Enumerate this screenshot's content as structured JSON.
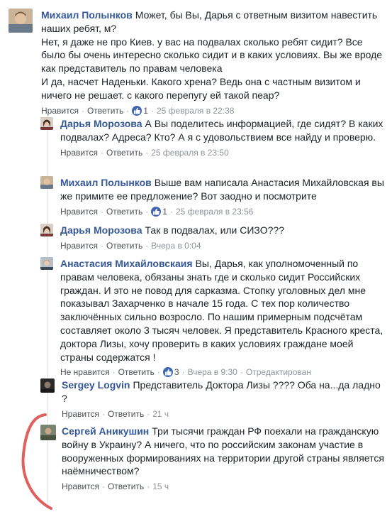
{
  "colors": {
    "author_link": "#365899",
    "action_link": "#4b4f56",
    "meta_text": "#90949c",
    "reaction_blue": "#4267b2",
    "annotation_red": "#e0605e"
  },
  "comments": [
    {
      "author": "Михаил Полынков",
      "paragraphs": [
        "Может, бы Вы, Дарья с ответным визитом навестить наших ребят, м?",
        "Нет, я даже не про Киев. у вас на подвалах сколько ребят сидит? Все было бы очень интересно сколько сидит и в каких условиях. Вы же вроде как представитель по правам человека",
        "И да, насчет Наденьки. Какого хрена? Ведь она с частным визитом и ничего не решает. с какого перепугу ей такой пеар?"
      ],
      "like_label": "Нравится",
      "reply_label": "Ответить",
      "reaction_icon": "like-icon",
      "reaction_count": "1",
      "timestamp": "25 февраля в 22:38"
    },
    {
      "author": "Дарья Морозова",
      "paragraphs": [
        "А Вы поделитесь информацией, где сидят? В каких подвалах? Адреса? Кто? А я с удовольствием все найду и проверю."
      ],
      "like_label": "Нравится",
      "reply_label": "Ответить",
      "timestamp": "25 февраля в 23:50"
    },
    {
      "author": "Михаил Полынков",
      "paragraphs": [
        "Выше вам написала Анастасия Михайловская вы же примите ее предложение? Вот заодно и посмотрите"
      ],
      "like_label": "Нравится",
      "reply_label": "Ответить",
      "reaction_icon": "like-icon",
      "reaction_count": "1",
      "timestamp": "25 февраля в 23:56"
    },
    {
      "author": "Дарья Морозова",
      "paragraphs": [
        "Так в подвалах, или СИЗО???"
      ],
      "like_label": "Нравится",
      "reply_label": "Ответить",
      "timestamp": "Вчера в 0:04"
    },
    {
      "author": "Анастасия Михайловскаия",
      "paragraphs": [
        "Вы, Дарья, как уполномоченный по правам человека, обязаны знать где и сколько сидит Российских граждан. И это не повод для сарказма. Стопку уголовных дел мне показывал Захарченко в начале 15 года. С тех пор количество заключённых сильно возросло. По нашим примерным подсчётам составляет около 3 тысяч человек. Я представитель Красного креста, доктора Лизы, хочу проверить в каких условиях граждане моей страны содержатся !"
      ],
      "like_label": "Не нравится",
      "reply_label": "Ответить",
      "reaction_icon": "like-icon",
      "reaction_count": "3",
      "timestamp": "Вчера в 9:30",
      "edited_label": "Отредактирован"
    },
    {
      "author": "Sergey Logvin",
      "paragraphs": [
        "Представитель Доктора Лизы ???? Оба на...да ладно ?"
      ],
      "like_label": "Нравится",
      "reply_label": "Ответить",
      "timestamp": "21 ч"
    },
    {
      "author": "Сергей Аникушин",
      "paragraphs": [
        "Три тысячи граждан РФ поехали на гражданскую войну в Украину? А ничего, что по российским законам участие в вооруженных формированиях на территории другой страны является наёмничеством?"
      ],
      "like_label": "Нравится",
      "reply_label": "Ответить",
      "timestamp": "15 ч"
    }
  ]
}
